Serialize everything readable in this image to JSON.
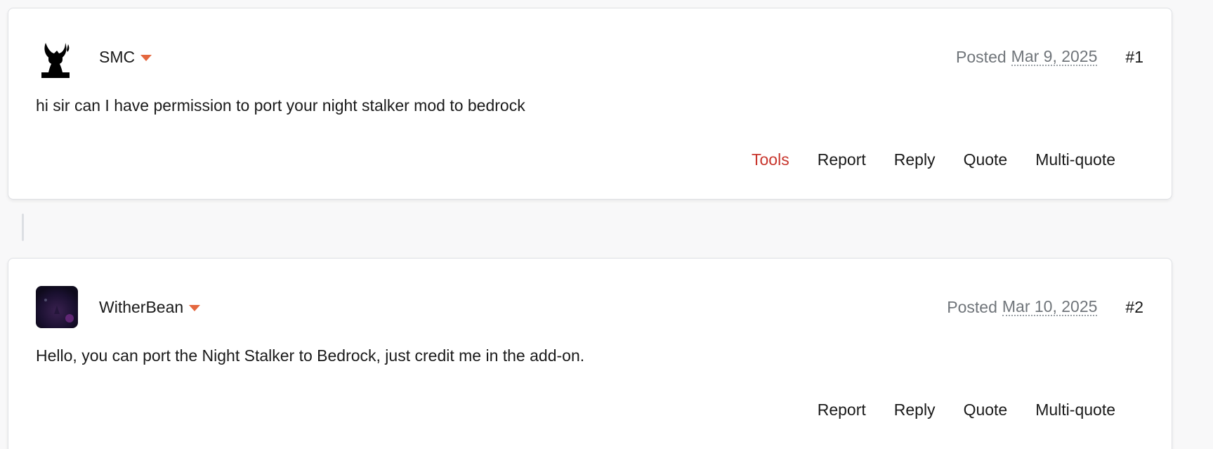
{
  "posts": [
    {
      "author": "SMC",
      "posted_label": "Posted",
      "date": "Mar 9, 2025",
      "number": "#1",
      "body": "hi sir can I have permission to port your night stalker mod to bedrock",
      "actions": {
        "tools": "Tools",
        "report": "Report",
        "reply": "Reply",
        "quote": "Quote",
        "multiquote": "Multi-quote"
      },
      "avatar_icon": "horned-silhouette-avatar"
    },
    {
      "author": "WitherBean",
      "posted_label": "Posted",
      "date": "Mar 10, 2025",
      "number": "#2",
      "body": "Hello, you can port the Night Stalker to Bedrock, just credit me in the add-on.",
      "actions": {
        "report": "Report",
        "reply": "Reply",
        "quote": "Quote",
        "multiquote": "Multi-quote"
      },
      "avatar_icon": "dark-purple-avatar"
    }
  ],
  "colors": {
    "accent_caret": "#e4673f",
    "tools_link": "#c8352c",
    "muted_text": "#70757a"
  }
}
